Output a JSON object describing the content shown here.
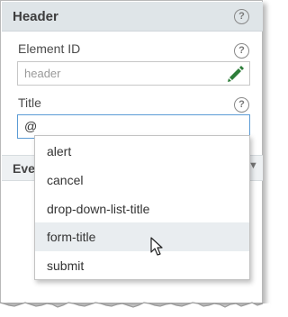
{
  "panel": {
    "title": "Header",
    "help_icon": "?"
  },
  "element_id": {
    "label": "Element ID",
    "placeholder": "header",
    "help_icon": "?"
  },
  "title_field": {
    "label": "Title",
    "value": "@",
    "help_icon": "?"
  },
  "events": {
    "label": "Eve"
  },
  "dropdown": {
    "options": [
      "alert",
      "cancel",
      "drop-down-list-title",
      "form-title",
      "submit"
    ],
    "hovered_option": "form-title"
  },
  "colors": {
    "header_bg": "#dfe5e8",
    "focus_border": "#5b9bd5",
    "hover_bg": "#e9edf0",
    "pencil_green": "#2e7d3a"
  }
}
